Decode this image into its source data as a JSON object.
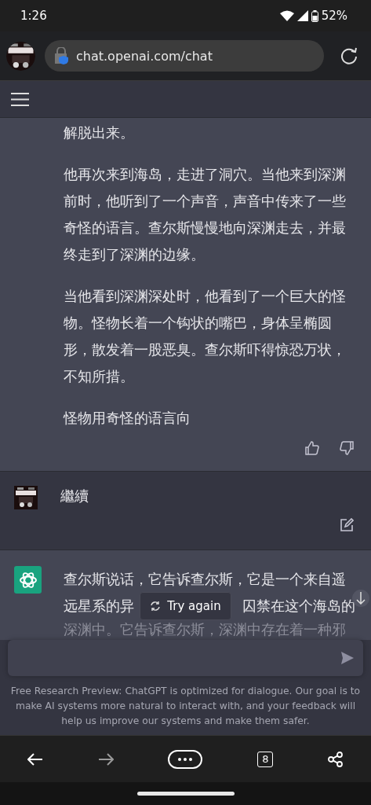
{
  "status_bar": {
    "time": "1:26",
    "battery": "52%"
  },
  "browser": {
    "url": "chat.openai.com/chat"
  },
  "messages": [
    {
      "kind": "reply",
      "paragraphs": [
        "解脱出来。",
        "他再次来到海岛，走进了洞穴。当他来到深渊前时，他听到了一个声音，声音中传来了一些奇怪的语言。查尔斯慢慢地向深渊走去，并最终走到了深渊的边缘。",
        "当他看到深渊深处时，他看到了一个巨大的怪物。怪物长着一个钩状的嘴巴，身体呈椭圆形，散发着一股恶臭。查尔斯吓得惊恐万状，不知所措。",
        "怪物用奇怪的语言向"
      ]
    },
    {
      "kind": "prompt",
      "paragraphs": [
        "繼續"
      ]
    },
    {
      "kind": "streaming",
      "lines": [
        [
          "查尔斯说话，它告诉查尔斯，它是一个来自遥"
        ],
        [
          "远星系的异",
          "囚禁在这个海岛的"
        ],
        [
          "深渊中。它告诉查尔斯，深渊中存在着一种邪"
        ]
      ]
    }
  ],
  "try_again": {
    "label": "Try again"
  },
  "footer": "Free Research Preview: ChatGPT is optimized for dialogue. Our goal is to make AI systems more natural to interact with, and your feedback will help us improve our systems and make them safer.",
  "nav": {
    "tab_count": "8"
  }
}
